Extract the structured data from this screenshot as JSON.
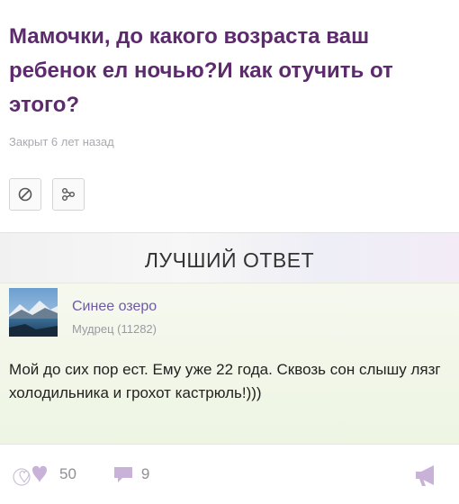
{
  "question": {
    "title": "Мамочки, до какого возраста ваш ребенок ел ночью?И как отучить от этого?",
    "status": "Закрыт 6 лет назад"
  },
  "actions": {
    "block_icon": "block-icon",
    "share_icon": "share-icon"
  },
  "best_answer": {
    "header": "ЛУЧШИЙ ОТВЕТ",
    "author": {
      "name": "Синее озеро",
      "rank": "Мудрец (11282)",
      "avatar_icon": "lake-avatar"
    },
    "text": "Мой до сих пор ест. Ему уже 22 года. Сквозь сон слышу лязг холодильника и грохот кастрюль!)))"
  },
  "footer": {
    "likes": "50",
    "comments": "9"
  },
  "colors": {
    "title": "#5d2a6e",
    "author": "#6f5aa7",
    "icon": "#c8b2d8"
  }
}
